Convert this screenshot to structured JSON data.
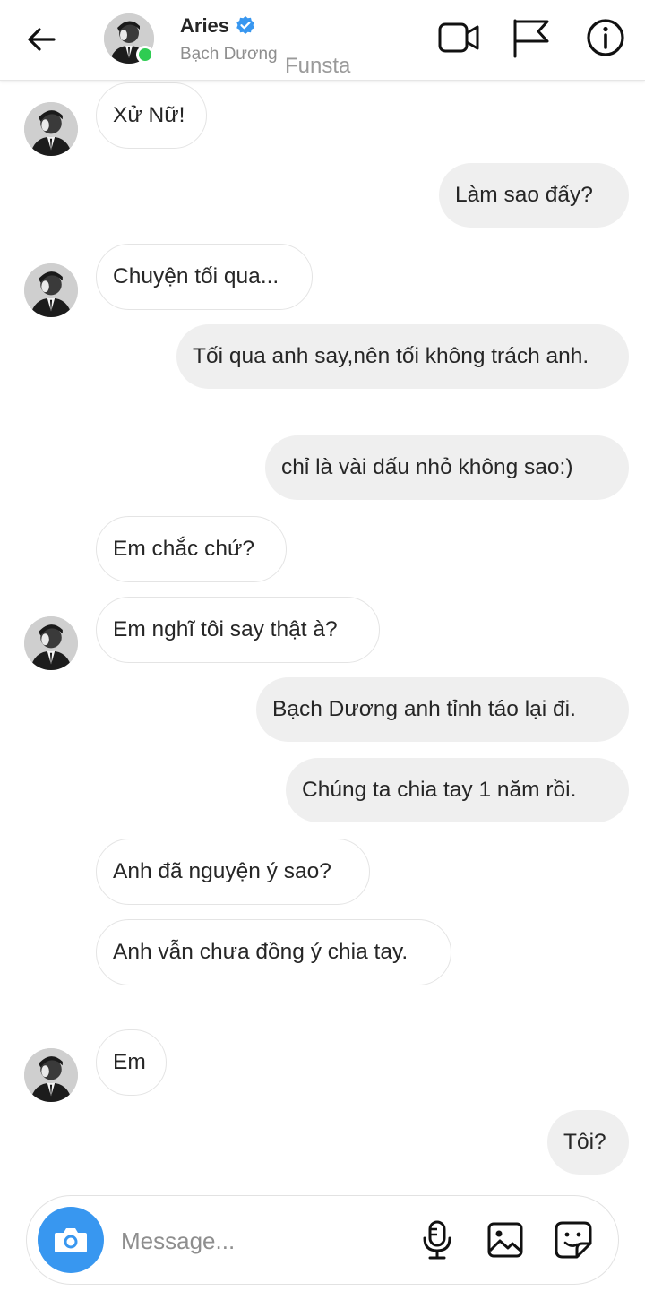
{
  "header": {
    "title": "Aries",
    "subtitle": "Bạch Dương",
    "watermark": "Funsta"
  },
  "icons": {
    "back": "arrow-left-icon",
    "verified": "verified-badge-icon",
    "video": "video-call-icon",
    "flag": "flag-icon",
    "info": "info-icon",
    "camera": "camera-icon",
    "mic": "microphone-icon",
    "gallery": "image-icon",
    "sticker": "sticker-icon"
  },
  "colors": {
    "accent": "#3897f0",
    "online": "#2ecc52",
    "outgoing_bubble": "#efefef",
    "incoming_border": "#e4e4e4"
  },
  "messages": [
    {
      "side": "in",
      "text": "Xử Nữ!",
      "avatar": true
    },
    {
      "side": "out",
      "text": "Làm sao đấy?"
    },
    {
      "side": "in",
      "text": "Chuyện tối qua...",
      "avatar": true
    },
    {
      "side": "out",
      "text": "Tối qua anh say,nên tối không trách anh."
    },
    {
      "side": "out",
      "text": "chỉ là vài dấu nhỏ không sao:)"
    },
    {
      "side": "in",
      "text": "Em chắc chứ?",
      "avatar": false
    },
    {
      "side": "in",
      "text": "Em nghĩ tôi say thật à?",
      "avatar": true
    },
    {
      "side": "out",
      "text": "Bạch Dương anh tỉnh táo lại đi."
    },
    {
      "side": "out",
      "text": "Chúng ta chia tay 1 năm rồi."
    },
    {
      "side": "in",
      "text": "Anh đã nguyện ý sao?",
      "avatar": false
    },
    {
      "side": "in",
      "text": "Anh vẫn chưa đồng ý chia tay.",
      "avatar": false
    },
    {
      "side": "in",
      "text": "Em",
      "avatar": true
    },
    {
      "side": "out",
      "text": "Tôi?"
    }
  ],
  "composer": {
    "placeholder": "Message..."
  }
}
